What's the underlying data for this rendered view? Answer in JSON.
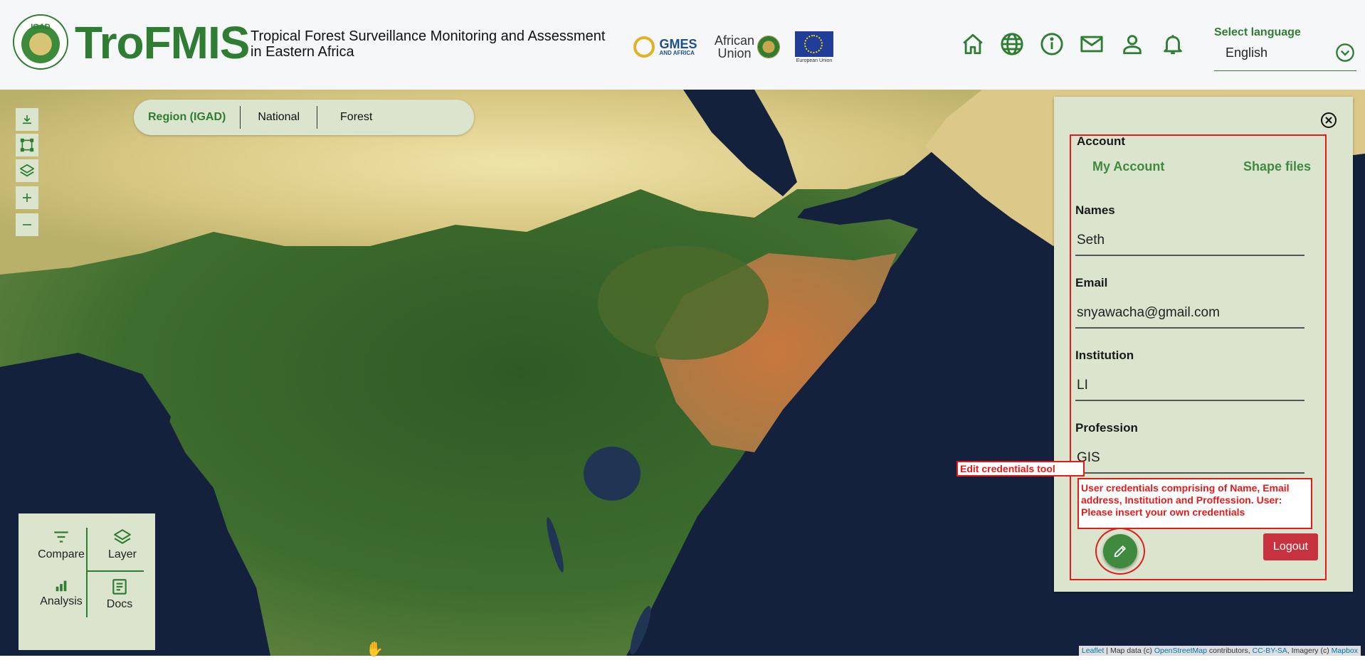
{
  "header": {
    "logo_text": "IGAD",
    "brand": "TroFMIS",
    "subtitle_line1": "Tropical Forest Surveillance Monitoring and Assessment",
    "subtitle_line2": "in Eastern Africa",
    "partners": {
      "gmes_main": "GMES",
      "gmes_sub": "AND AFRICA",
      "au_line1": "African",
      "au_line2": "Union",
      "eu_caption": "European Union"
    },
    "nav_icons": [
      "home-icon",
      "globe-icon",
      "info-icon",
      "mail-icon",
      "user-icon",
      "bell-icon"
    ],
    "language": {
      "label": "Select language",
      "value": "English"
    }
  },
  "region_tabs": [
    "Region (IGAD)",
    "National",
    "Forest"
  ],
  "map_controls": [
    "download-icon",
    "draw-rectangle-icon",
    "layers-icon",
    "zoom-in-icon",
    "zoom-out-icon"
  ],
  "toolbox": {
    "compare": "Compare",
    "layer": "Layer",
    "analysis": "Analysis",
    "docs": "Docs"
  },
  "attribution": {
    "leaflet": "Leaflet",
    "text1": " | Map data (c) ",
    "osm": "OpenStreetMap",
    "text2": " contributors, ",
    "license": "CC-BY-SA",
    "text3": ", Imagery (c) ",
    "mapbox": "Mapbox"
  },
  "account_panel": {
    "title": "Account",
    "tabs": [
      "My Account",
      "Shape files"
    ],
    "fields": {
      "names": {
        "label": "Names",
        "value": "Seth"
      },
      "email": {
        "label": "Email",
        "value": "snyawacha@gmail.com"
      },
      "institution": {
        "label": "Institution",
        "value": "LI"
      },
      "profession": {
        "label": "Profession",
        "value": "GIS"
      }
    },
    "note": "User credentials comprising of Name, Email address, Institution and Proffession. User: Please insert your own credentials",
    "logout": "Logout",
    "edit_label": "Edit credentials tool"
  },
  "colors": {
    "brand_green": "#2f7d32",
    "panel_bg": "#dbe5cd",
    "annotation_red": "#e51b1b",
    "logout_red": "#c7323f"
  }
}
